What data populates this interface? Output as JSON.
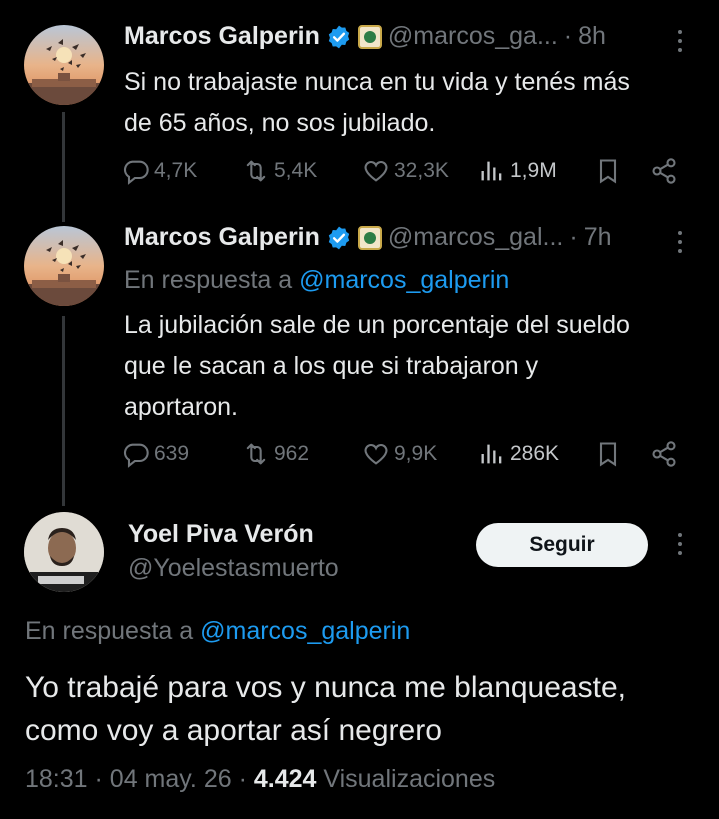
{
  "tweets": [
    {
      "author": "Marcos Galperin",
      "handle": "@marcos_ga...",
      "time": "8h",
      "text_lines": [
        "Si no trabajaste nunca en tu vida y tenés más",
        "de 65 años, no sos jubilado."
      ],
      "replies": "4,7K",
      "retweets": "5,4K",
      "likes": "32,3K",
      "views": "1,9M"
    },
    {
      "author": "Marcos Galperin",
      "handle": "@marcos_gal...",
      "time": "7h",
      "reply_prefix": "En respuesta a",
      "reply_to": "@marcos_galperin",
      "text_lines": [
        "La jubilación sale de un porcentaje del sueldo",
        "que le sacan a los que si trabajaron y",
        "aportaron."
      ],
      "replies": "639",
      "retweets": "962",
      "likes": "9,9K",
      "views": "286K"
    }
  ],
  "main_tweet": {
    "author": "Yoel Piva Verón",
    "handle": "@Yoelestasmuerto",
    "follow_label": "Seguir",
    "reply_prefix": "En respuesta a",
    "reply_to": "@marcos_galperin",
    "text_lines": [
      "Yo trabajé para vos y nunca me blanqueaste,",
      "como voy a aportar así negrero"
    ],
    "time": "18:31",
    "date": "04 may. 26",
    "views_count": "4.424",
    "views_label": "Visualizaciones"
  },
  "colors": {
    "background": "#000000",
    "text": "#e7e9ea",
    "muted": "#71767b",
    "accent": "#1d9bf0",
    "verified": "#1d9bf0"
  },
  "icons": [
    "verified-badge-icon",
    "emoji-badge-icon",
    "more-icon",
    "reply-icon",
    "retweet-icon",
    "like-icon",
    "views-icon",
    "bookmark-icon",
    "share-icon"
  ]
}
